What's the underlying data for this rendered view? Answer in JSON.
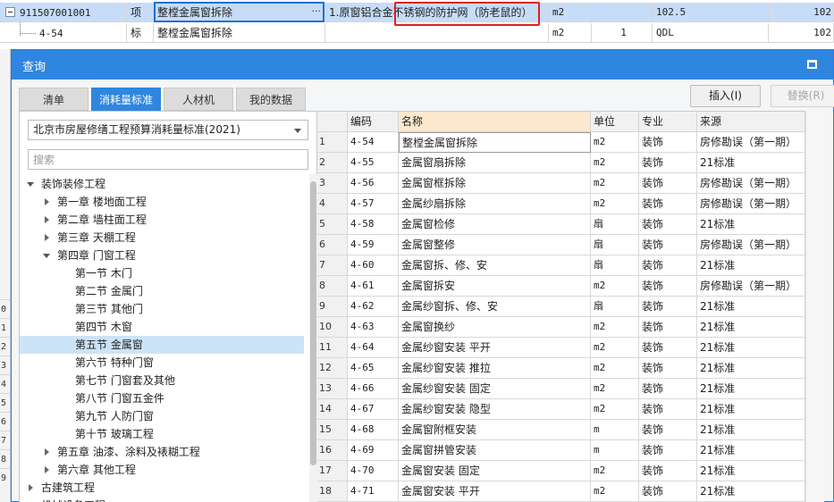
{
  "background": {
    "row1": {
      "code": "911507001001",
      "type": "项",
      "name": "整樘金属窗拆除",
      "feature": "1.原窗铝合金",
      "highlight": "不锈钢的防护网（防老鼠的）",
      "unit": "m2",
      "qty": "102.5",
      "amount": "102"
    },
    "row2": {
      "code": "4-54",
      "type": "标",
      "name": "整樘金属窗拆除",
      "unit": "m2",
      "qty": "1",
      "expr": "QDL",
      "amount": "102"
    },
    "left_numbers": [
      "0",
      "1",
      "2",
      "3",
      "4",
      "5",
      "6",
      "7",
      "8",
      "9"
    ]
  },
  "dialog": {
    "title": "查询",
    "tabs": [
      "清单",
      "消耗量标准",
      "人材机",
      "我的数据"
    ],
    "active_tab": 1,
    "insert_button": "插入(I)",
    "replace_button": "替换(R)",
    "standard_select": "北京市房屋修缮工程预算消耗量标准(2021)",
    "search_placeholder": "搜索",
    "tree": [
      {
        "label": "装饰装修工程",
        "level": 0,
        "state": "open"
      },
      {
        "label": "第一章 楼地面工程",
        "level": 1,
        "state": "closed"
      },
      {
        "label": "第二章 墙柱面工程",
        "level": 1,
        "state": "closed"
      },
      {
        "label": "第三章 天棚工程",
        "level": 1,
        "state": "closed"
      },
      {
        "label": "第四章 门窗工程",
        "level": 1,
        "state": "open"
      },
      {
        "label": "第一节 木门",
        "level": 2,
        "state": "leaf"
      },
      {
        "label": "第二节 金属门",
        "level": 2,
        "state": "leaf"
      },
      {
        "label": "第三节 其他门",
        "level": 2,
        "state": "leaf"
      },
      {
        "label": "第四节 木窗",
        "level": 2,
        "state": "leaf"
      },
      {
        "label": "第五节 金属窗",
        "level": 2,
        "state": "leaf",
        "selected": true
      },
      {
        "label": "第六节 特种门窗",
        "level": 2,
        "state": "leaf"
      },
      {
        "label": "第七节 门窗套及其他",
        "level": 2,
        "state": "leaf"
      },
      {
        "label": "第八节 门窗五金件",
        "level": 2,
        "state": "leaf"
      },
      {
        "label": "第九节 人防门窗",
        "level": 2,
        "state": "leaf"
      },
      {
        "label": "第十节 玻璃工程",
        "level": 2,
        "state": "leaf"
      },
      {
        "label": "第五章 油漆、涂料及裱糊工程",
        "level": 1,
        "state": "closed"
      },
      {
        "label": "第六章 其他工程",
        "level": 1,
        "state": "closed"
      },
      {
        "label": "古建筑工程",
        "level": 0,
        "state": "closed"
      },
      {
        "label": "机械设备工程",
        "level": 0,
        "state": "closed"
      }
    ],
    "grid": {
      "headers": [
        "",
        "编码",
        "名称",
        "单位",
        "专业",
        "来源"
      ],
      "rows": [
        [
          "1",
          "4-54",
          "整樘金属窗拆除",
          "m2",
          "装饰",
          "房修勘误（第一期）"
        ],
        [
          "2",
          "4-55",
          "金属窗扇拆除",
          "m2",
          "装饰",
          "21标准"
        ],
        [
          "3",
          "4-56",
          "金属窗框拆除",
          "m2",
          "装饰",
          "房修勘误（第一期）"
        ],
        [
          "4",
          "4-57",
          "金属纱扇拆除",
          "m2",
          "装饰",
          "房修勘误（第一期）"
        ],
        [
          "5",
          "4-58",
          "金属窗检修",
          "扇",
          "装饰",
          "21标准"
        ],
        [
          "6",
          "4-59",
          "金属窗整修",
          "扇",
          "装饰",
          "房修勘误（第一期）"
        ],
        [
          "7",
          "4-60",
          "金属窗拆、修、安",
          "扇",
          "装饰",
          "21标准"
        ],
        [
          "8",
          "4-61",
          "金属窗拆安",
          "m2",
          "装饰",
          "房修勘误（第一期）"
        ],
        [
          "9",
          "4-62",
          "金属纱窗拆、修、安",
          "扇",
          "装饰",
          "21标准"
        ],
        [
          "10",
          "4-63",
          "金属窗换纱",
          "m2",
          "装饰",
          "21标准"
        ],
        [
          "11",
          "4-64",
          "金属纱窗安装 平开",
          "m2",
          "装饰",
          "21标准"
        ],
        [
          "12",
          "4-65",
          "金属纱窗安装 推拉",
          "m2",
          "装饰",
          "21标准"
        ],
        [
          "13",
          "4-66",
          "金属纱窗安装 固定",
          "m2",
          "装饰",
          "21标准"
        ],
        [
          "14",
          "4-67",
          "金属纱窗安装 隐型",
          "m2",
          "装饰",
          "21标准"
        ],
        [
          "15",
          "4-68",
          "金属窗附框安装",
          "m",
          "装饰",
          "21标准"
        ],
        [
          "16",
          "4-69",
          "金属窗拼管安装",
          "m",
          "装饰",
          "21标准"
        ],
        [
          "17",
          "4-70",
          "金属窗安装 固定",
          "m2",
          "装饰",
          "21标准"
        ],
        [
          "18",
          "4-71",
          "金属窗安装 平开",
          "m2",
          "装饰",
          "21标准"
        ]
      ]
    }
  }
}
